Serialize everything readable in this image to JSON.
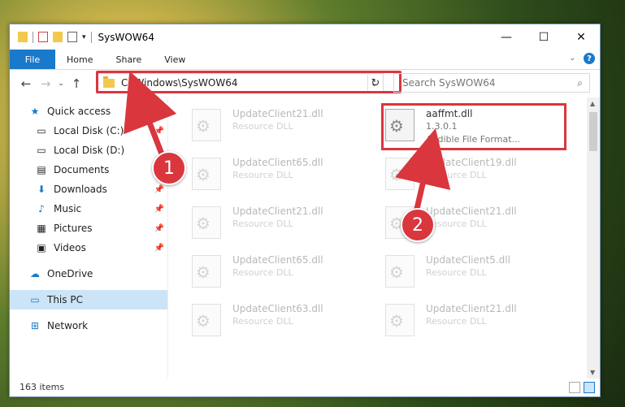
{
  "window": {
    "title": "SysWOW64",
    "minimize": "—",
    "maximize": "☐",
    "close": "✕"
  },
  "ribbon": {
    "tabs": [
      "File",
      "Home",
      "Share",
      "View"
    ],
    "help": "?"
  },
  "navigation": {
    "path": "C:\\Windows\\SysWOW64",
    "search_placeholder": "Search SysWOW64"
  },
  "sidebar": {
    "items": [
      {
        "label": "Quick access",
        "icon": "star-icon"
      },
      {
        "label": "Local Disk (C:)",
        "icon": "drive-icon"
      },
      {
        "label": "Local Disk (D:)",
        "icon": "drive-icon"
      },
      {
        "label": "Documents",
        "icon": "document-icon"
      },
      {
        "label": "Downloads",
        "icon": "download-icon"
      },
      {
        "label": "Music",
        "icon": "music-icon"
      },
      {
        "label": "Pictures",
        "icon": "picture-icon"
      },
      {
        "label": "Videos",
        "icon": "video-icon"
      },
      {
        "label": "OneDrive",
        "icon": "cloud-icon"
      },
      {
        "label": "This PC",
        "icon": "computer-icon"
      },
      {
        "label": "Network",
        "icon": "network-icon"
      }
    ]
  },
  "files": [
    {
      "name": "UpdateClient21.dll",
      "type": "Resource DLL"
    },
    {
      "name": "aaffmt.dll",
      "version": "1.3.0.1",
      "description": "Audible File Format..."
    },
    {
      "name": "UpdateClient65.dll",
      "type": "Resource DLL"
    },
    {
      "name": "UpdateClient19.dll",
      "type": "Resource DLL"
    },
    {
      "name": "UpdateClient21.dll",
      "type": "Resource DLL"
    },
    {
      "name": "UpdateClient21.dll",
      "type": "Resource DLL"
    },
    {
      "name": "UpdateClient65.dll",
      "type": "Resource DLL"
    },
    {
      "name": "UpdateClient5.dll",
      "type": "Resource DLL"
    },
    {
      "name": "UpdateClient63.dll",
      "type": "Resource DLL"
    },
    {
      "name": "UpdateClient21.dll",
      "type": "Resource DLL"
    }
  ],
  "status": {
    "item_count": "163 items"
  },
  "annotations": {
    "step1": "1",
    "step2": "2"
  },
  "colors": {
    "accent": "#1979ca",
    "highlight": "#d9363e"
  }
}
